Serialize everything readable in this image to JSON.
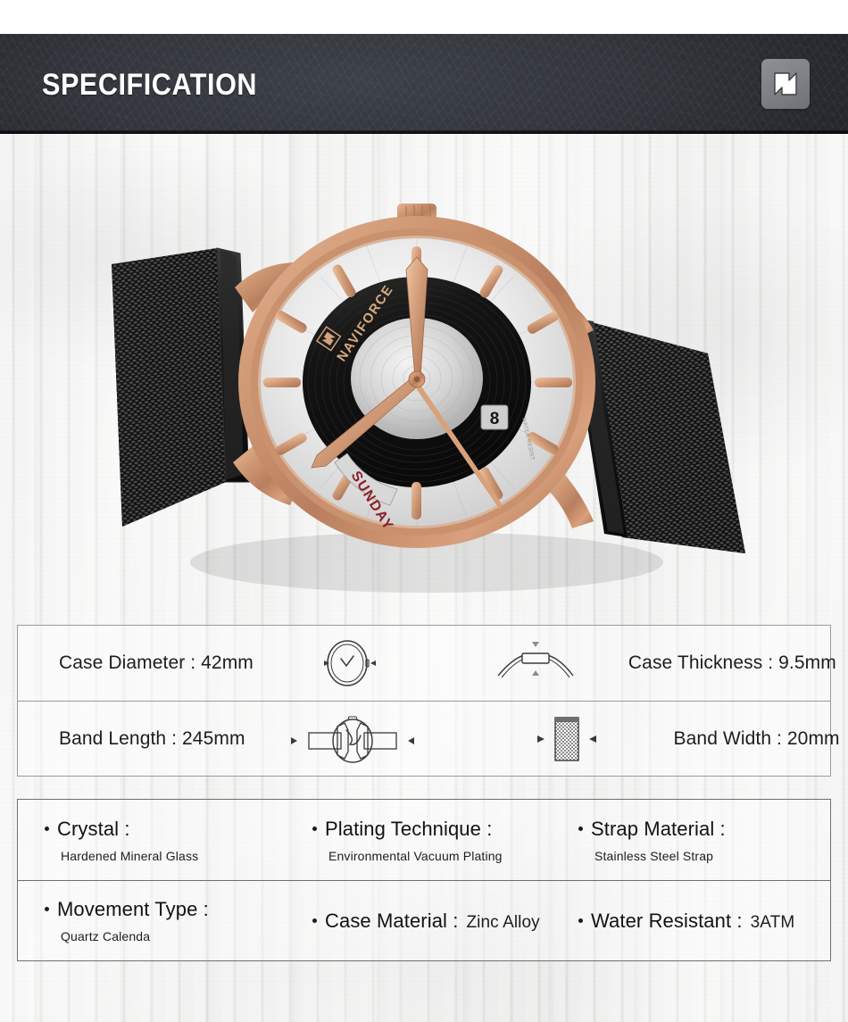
{
  "header": {
    "title": "SPECIFICATION",
    "logo_icon": "naviforce-n-logo-icon",
    "background_color": "#2e3238",
    "title_color": "#ffffff",
    "badge_color": "#7d8085"
  },
  "product_photo": {
    "alt_name": "naviforce-rose-gold-mesh-watch",
    "dial_brand": "NAVIFORCE",
    "dial_day_window": "SUNDAY",
    "dial_date_window": "8",
    "case_color": "#c08b68",
    "band_color": "#1a1a1a",
    "dial_ring_color": "#111111",
    "background_color": "#eeeeee"
  },
  "dimensions_table": {
    "rows": [
      {
        "left_label": "Case Diameter : 42mm",
        "left_icon": "watch-case-diameter-icon",
        "right_icon": "watch-case-thickness-icon",
        "right_label": "Case Thickness : 9.5mm"
      },
      {
        "left_label": "Band Length : 245mm",
        "left_icon": "watch-band-length-icon",
        "right_icon": "watch-band-width-icon",
        "right_label": "Band Width : 20mm"
      }
    ]
  },
  "materials_table": {
    "rows": [
      [
        {
          "title": "Crystal :",
          "value_inline": "",
          "value_below": "Hardened Mineral Glass"
        },
        {
          "title": "Plating Technique :",
          "value_inline": "",
          "value_below": "Environmental Vacuum Plating"
        },
        {
          "title": "Strap Material :",
          "value_inline": "",
          "value_below": "Stainless Steel Strap"
        }
      ],
      [
        {
          "title": "Movement Type :",
          "value_inline": "",
          "value_below": "Quartz Calenda"
        },
        {
          "title": "Case Material :",
          "value_inline": "Zinc Alloy",
          "value_below": ""
        },
        {
          "title": "Water Resistant :",
          "value_inline": "3ATM",
          "value_below": ""
        }
      ]
    ]
  }
}
